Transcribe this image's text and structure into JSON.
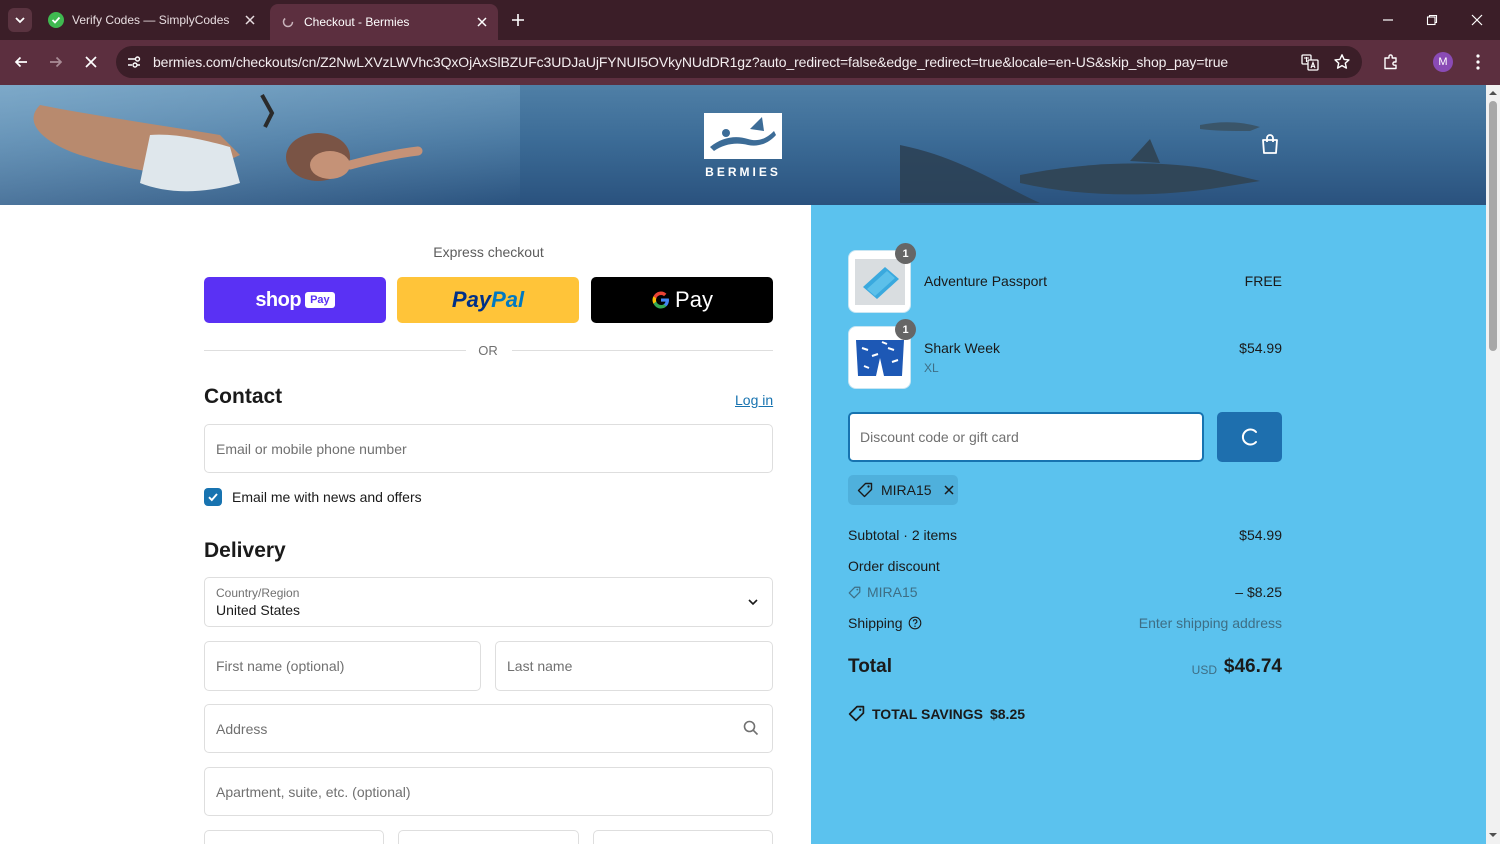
{
  "browser": {
    "tabs": [
      {
        "title": "Verify Codes — SimplyCodes",
        "active": false
      },
      {
        "title": "Checkout - Bermies",
        "active": true
      }
    ],
    "url": "bermies.com/checkouts/cn/Z2NwLXVzLWVhc3QxOjAxSlBZUFc3UDJaUjFYNUI5OVkyNUdDR1gz?auto_redirect=false&edge_redirect=true&locale=en-US&skip_shop_pay=true",
    "profile_initial": "M",
    "accent": "#5c2f3f"
  },
  "header": {
    "brand": "BERMIES",
    "icons": {
      "cart": "shopping-bag-icon"
    }
  },
  "express": {
    "title": "Express checkout",
    "shoppay_label": "shop",
    "shoppay_badge": "Pay",
    "paypal_label_a": "Pay",
    "paypal_label_b": "Pal",
    "gpay_label": "Pay",
    "or": "OR"
  },
  "contact": {
    "heading": "Contact",
    "login": "Log in",
    "email_placeholder": "Email or mobile phone number",
    "newsletter_label": "Email me with news and offers",
    "newsletter_checked": true
  },
  "delivery": {
    "heading": "Delivery",
    "country_label": "Country/Region",
    "country_value": "United States",
    "first_name_placeholder": "First name (optional)",
    "last_name_placeholder": "Last name",
    "address_placeholder": "Address",
    "apartment_placeholder": "Apartment, suite, etc. (optional)"
  },
  "summary": {
    "items": [
      {
        "name": "Adventure Passport",
        "variant": "",
        "qty": "1",
        "price": "FREE"
      },
      {
        "name": "Shark Week",
        "variant": "XL",
        "qty": "1",
        "price": "$54.99"
      }
    ],
    "discount_placeholder": "Discount code or gift card",
    "applied_code": "MIRA15",
    "subtotal_label": "Subtotal · 2 items",
    "subtotal_value": "$54.99",
    "order_discount_label": "Order discount",
    "discount_code": "MIRA15",
    "discount_value": "– $8.25",
    "shipping_label": "Shipping",
    "shipping_value": "Enter shipping address",
    "total_label": "Total",
    "currency": "USD",
    "total_value": "$46.74",
    "savings_label": "TOTAL SAVINGS",
    "savings_value": "$8.25",
    "panel_color": "#5bc2ee"
  }
}
